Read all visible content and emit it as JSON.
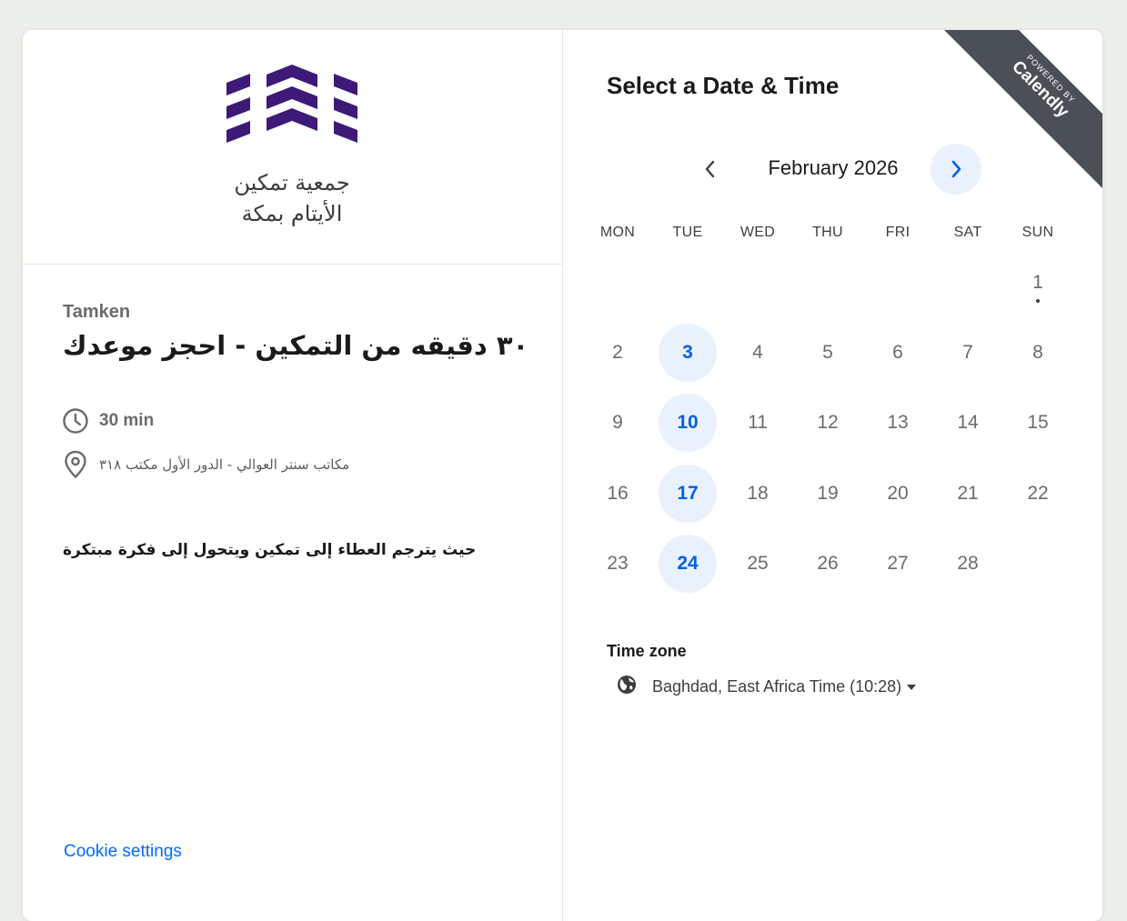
{
  "colors": {
    "accent": "#0069ff",
    "brand_purple": "#3d1a78",
    "available_bg": "#e9f1fd",
    "ribbon_bg": "#4b5057"
  },
  "logo": {
    "line1": "جمعية تمكين",
    "line2": "الأيتام بمكة"
  },
  "event": {
    "organizer": "Tamken",
    "title": "٣٠ دقيقه من التمكين - احجز موعدك",
    "duration": "30 min",
    "location": "مكاتب سنتر العوالي - الدور الأول مكتب ٣١٨",
    "description": "حيث يترجم العطاء إلى تمكين ويتحول إلى فكرة مبتكرة"
  },
  "footer": {
    "cookie_settings": "Cookie settings"
  },
  "calendar": {
    "title": "Select a Date & Time",
    "month": "February 2026",
    "weekdays": [
      "MON",
      "TUE",
      "WED",
      "THU",
      "FRI",
      "SAT",
      "SUN"
    ],
    "days": [
      {
        "d": "1",
        "col": 6,
        "row": 0,
        "available": false,
        "dot": true
      },
      {
        "d": "2",
        "col": 0,
        "row": 1,
        "available": false
      },
      {
        "d": "3",
        "col": 1,
        "row": 1,
        "available": true
      },
      {
        "d": "4",
        "col": 2,
        "row": 1,
        "available": false
      },
      {
        "d": "5",
        "col": 3,
        "row": 1,
        "available": false
      },
      {
        "d": "6",
        "col": 4,
        "row": 1,
        "available": false
      },
      {
        "d": "7",
        "col": 5,
        "row": 1,
        "available": false
      },
      {
        "d": "8",
        "col": 6,
        "row": 1,
        "available": false
      },
      {
        "d": "9",
        "col": 0,
        "row": 2,
        "available": false
      },
      {
        "d": "10",
        "col": 1,
        "row": 2,
        "available": true
      },
      {
        "d": "11",
        "col": 2,
        "row": 2,
        "available": false
      },
      {
        "d": "12",
        "col": 3,
        "row": 2,
        "available": false
      },
      {
        "d": "13",
        "col": 4,
        "row": 2,
        "available": false
      },
      {
        "d": "14",
        "col": 5,
        "row": 2,
        "available": false
      },
      {
        "d": "15",
        "col": 6,
        "row": 2,
        "available": false
      },
      {
        "d": "16",
        "col": 0,
        "row": 3,
        "available": false
      },
      {
        "d": "17",
        "col": 1,
        "row": 3,
        "available": true
      },
      {
        "d": "18",
        "col": 2,
        "row": 3,
        "available": false
      },
      {
        "d": "19",
        "col": 3,
        "row": 3,
        "available": false
      },
      {
        "d": "20",
        "col": 4,
        "row": 3,
        "available": false
      },
      {
        "d": "21",
        "col": 5,
        "row": 3,
        "available": false
      },
      {
        "d": "22",
        "col": 6,
        "row": 3,
        "available": false
      },
      {
        "d": "23",
        "col": 0,
        "row": 4,
        "available": false
      },
      {
        "d": "24",
        "col": 1,
        "row": 4,
        "available": true
      },
      {
        "d": "25",
        "col": 2,
        "row": 4,
        "available": false
      },
      {
        "d": "26",
        "col": 3,
        "row": 4,
        "available": false
      },
      {
        "d": "27",
        "col": 4,
        "row": 4,
        "available": false
      },
      {
        "d": "28",
        "col": 5,
        "row": 4,
        "available": false
      }
    ]
  },
  "timezone": {
    "label": "Time zone",
    "value": "Baghdad, East Africa Time (10:28)"
  },
  "badge": {
    "powered_by": "POWERED BY",
    "brand": "Calendly"
  },
  "icons": {
    "duration": "clock-icon",
    "location": "map-pin-icon",
    "timezone": "globe-icon",
    "prev": "chevron-left-icon",
    "next": "chevron-right-icon"
  }
}
